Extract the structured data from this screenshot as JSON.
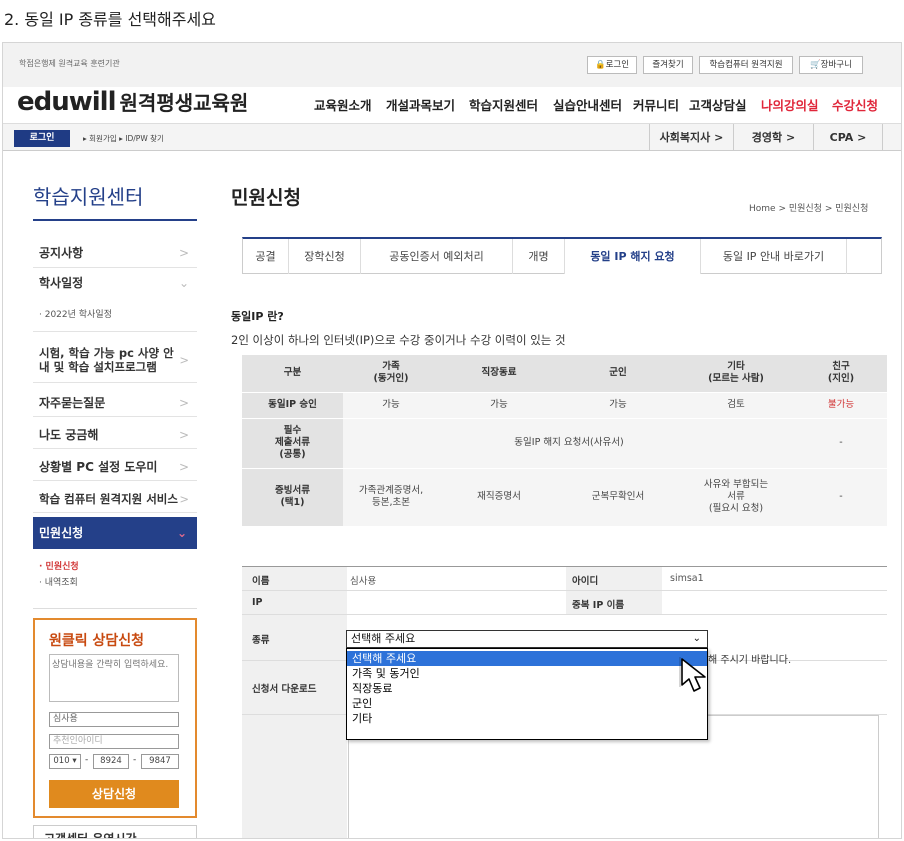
{
  "caption": "2. 동일 IP 종류를 선택해주세요",
  "topbar": {
    "org": "학점은행제 원격교육 훈련기관",
    "links": [
      "로그인",
      "즐겨찾기",
      "학습컴퓨터 원격지원",
      "장바구니"
    ]
  },
  "logo": {
    "brand": "eduwill",
    "name": "원격평생교육원"
  },
  "gnb": [
    "교육원소개",
    "개설과목보기",
    "학습지원센터",
    "실습안내센터",
    "커뮤니티",
    "고객상담실",
    "나의강의실",
    "수강신청"
  ],
  "gnb_colors": {
    "highlight": "#e0263a"
  },
  "subbar": {
    "login": "로그인",
    "links": "▸ 회원가입 ▸ ID/PW 찾기",
    "sidetabs": [
      "사회복지사 >",
      "경영학 >",
      "CPA >"
    ]
  },
  "lnb": {
    "title": "학습지원센터",
    "items": [
      {
        "label": "공지사항",
        "arrow": ">"
      },
      {
        "label": "학사일정",
        "arrow": "⌄"
      },
      {
        "label": "시험, 학습 가능 pc 사양 안내 및 학습 설치프로그램",
        "arrow": ">"
      },
      {
        "label": "자주묻는질문",
        "arrow": ">"
      },
      {
        "label": "나도 궁금해",
        "arrow": ">"
      },
      {
        "label": "상황별 PC 설정 도우미",
        "arrow": ">"
      },
      {
        "label": "학습 컴퓨터 원격지원 서비스",
        "arrow": ">"
      }
    ],
    "sub_schedule": "· 2022년 학사일정",
    "selected": "민원신청",
    "sub_selected": [
      "· 민원신청",
      "· 내역조회"
    ]
  },
  "consult": {
    "title": "원클릭 상담신청",
    "placeholder": "상담내용을 간략히 입력하세요.",
    "name": "심사용",
    "referrer": "추천인아이디",
    "phone": [
      "010 ▾",
      "8924",
      "9847"
    ],
    "submit": "상담신청",
    "bottom": "고객센터 운영시간"
  },
  "page": {
    "title": "민원신청",
    "breadcrumb": "Home > 민원신청 > 민원신청"
  },
  "tabs": [
    "공결",
    "장학신청",
    "공동인증서 예외처리",
    "개명",
    "동일 IP 해지 요청",
    "동일 IP 안내 바로가기"
  ],
  "ip_section": {
    "title": "동일IP 란?",
    "desc": "2인 이상이 하나의 인터넷(IP)으로 수강 중이거나 수강 이력이 있는 것"
  },
  "ip_table": {
    "headers": [
      "구분",
      "가족\n(동거인)",
      "직장동료",
      "군인",
      "기타\n(모르는 사람)",
      "친구\n(지인)"
    ],
    "approve_label": "동일IP 승인",
    "approve": [
      "가능",
      "가능",
      "가능",
      "검토",
      "불가능"
    ],
    "required_label": "필수\n제출서류\n(공통)",
    "required_value": "동일IP 해지 요청서(사유서)",
    "required_last": "-",
    "proof_label": "증빙서류\n(택1)",
    "proof": [
      "가족관계증명서,\n등본,초본",
      "재직증명서",
      "군복무확인서",
      "사유와 부합되는\n서류\n(필요시 요청)",
      "-"
    ]
  },
  "form": {
    "name_label": "이름",
    "name_value": "심사용",
    "id_label": "아이디",
    "id_value": "simsa1",
    "ip_label": "IP",
    "dup_label": "중복 IP 이름",
    "type_label": "종류",
    "download_label": "신청서 다운로드",
    "hint": "해 주시기 바랍니다."
  },
  "select": {
    "value": "선택해 주세요",
    "options": [
      "선택해 주세요",
      "가족 및 동거인",
      "직장동료",
      "군인",
      "기타"
    ],
    "highlighted": 0,
    "highlight_color": "#2d72d9"
  }
}
